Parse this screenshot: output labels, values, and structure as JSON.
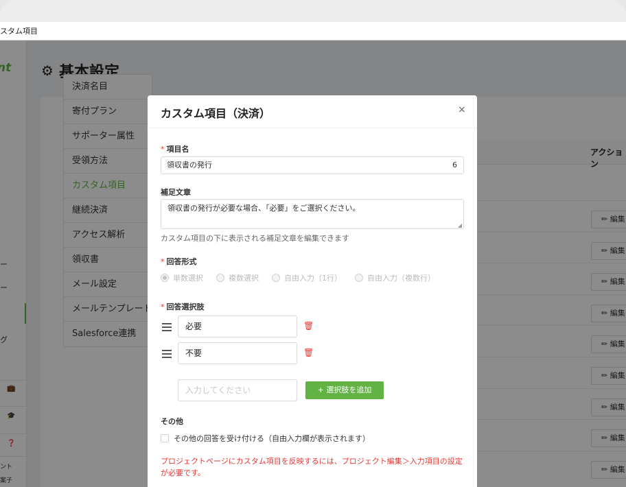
{
  "window": {
    "tab_title": "スタム項目"
  },
  "sidebar": {
    "logo": "nt",
    "items": [
      "ー",
      "ー",
      "グ"
    ],
    "bottom_texts": [
      "ント",
      "案子"
    ]
  },
  "page": {
    "title": "基本設定"
  },
  "menu": {
    "items": [
      {
        "label": "決済名目"
      },
      {
        "label": "寄付プラン"
      },
      {
        "label": "サポーター属性"
      },
      {
        "label": "受領方法"
      },
      {
        "label": "カスタム項目",
        "active": true
      },
      {
        "label": "継続決済"
      },
      {
        "label": "アクセス解析"
      },
      {
        "label": "領収書"
      },
      {
        "label": "メール設定"
      },
      {
        "label": "メールテンプレート"
      },
      {
        "label": "Salesforce連携"
      }
    ]
  },
  "table": {
    "action_header": "アクション",
    "edit_label": "編集"
  },
  "modal": {
    "title": "カスタム項目（決済）",
    "close": "×",
    "name_label": "項目名",
    "name_value": "領収書の発行",
    "name_count": "6",
    "desc_label": "補足文章",
    "desc_value": "領収書の発行が必要な場合、「必要」をご選択ください。",
    "desc_help": "カスタム項目の下に表示される補足文章を編集できます",
    "format_label": "回答形式",
    "formats": [
      "単数選択",
      "複数選択",
      "自由入力（1行）",
      "自由入力（複数行）"
    ],
    "choices_label": "回答選択肢",
    "choices": [
      "必要",
      "不要"
    ],
    "add_placeholder": "入力してください",
    "add_button": "+ 選択肢を追加",
    "other_label": "その他",
    "other_checkbox": "その他の回答を受け付ける（自由入力欄が表示されます）",
    "note": "プロジェクトページにカスタム項目を反映するには、プロジェクト編集＞入力項目の設定が必要です。"
  }
}
